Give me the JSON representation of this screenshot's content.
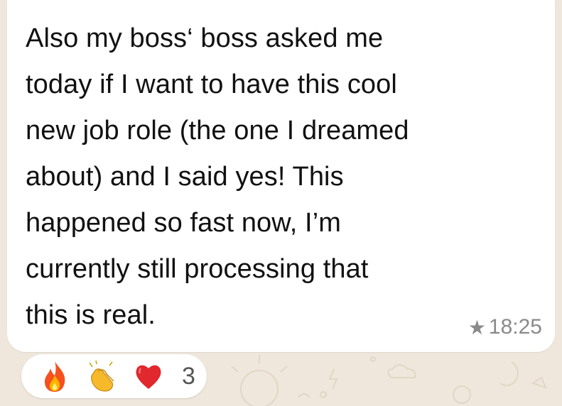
{
  "message": {
    "lines": [
      "Also my boss‘ boss asked me",
      "today if I want to have this cool",
      "new job role (the one I dreamed",
      "about) and I said yes! This",
      "happened so fast now, I’m",
      "currently still processing that",
      "this is real."
    ],
    "time": "18:25",
    "starred_icon": "star-icon"
  },
  "reactions": {
    "emojis": [
      "fire",
      "clapping-hands",
      "red-heart"
    ],
    "count": "3"
  },
  "colors": {
    "bubble": "#ffffff",
    "wallpaper": "#efe7dc",
    "text": "#111111",
    "meta": "#8a8a8a"
  }
}
